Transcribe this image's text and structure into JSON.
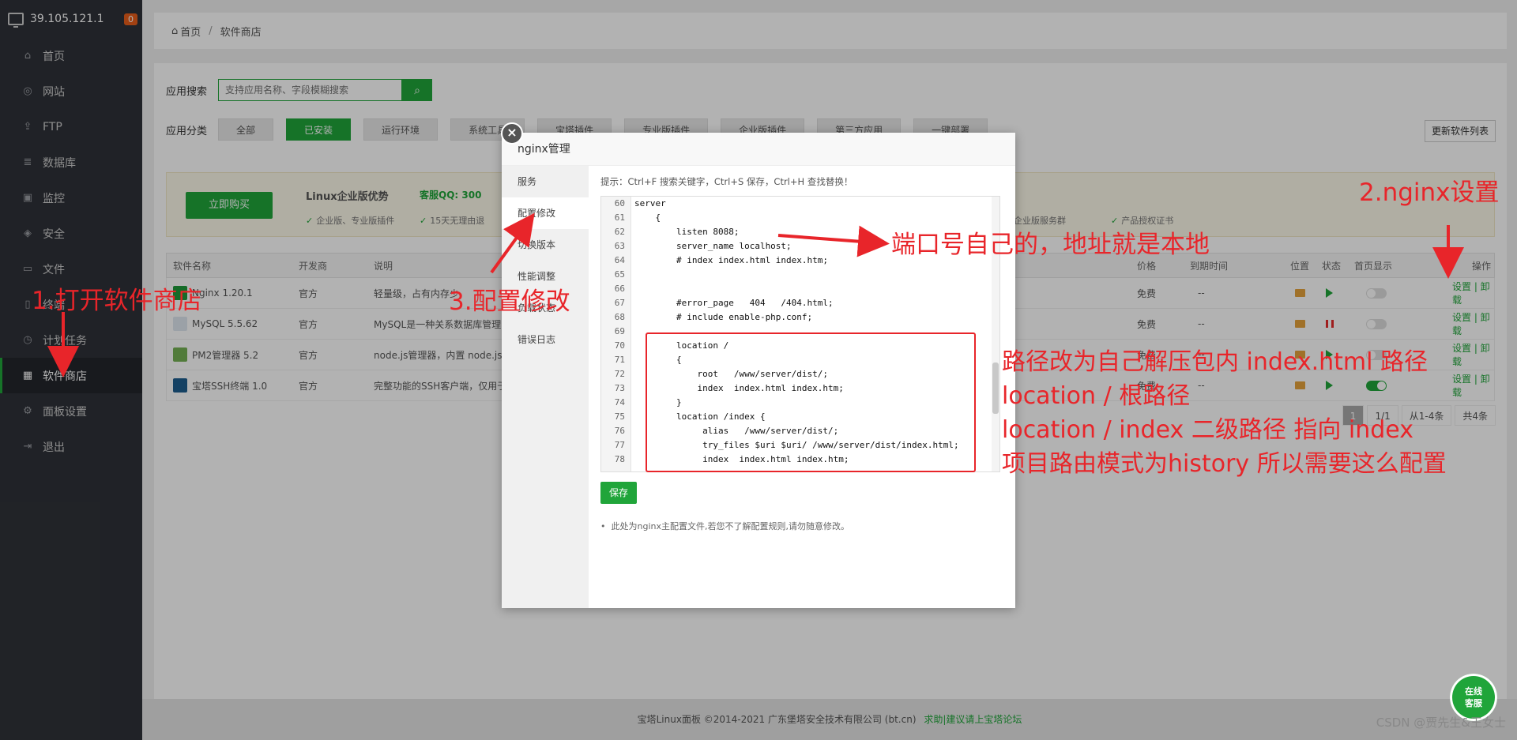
{
  "sidebar": {
    "ip": "39.105.121.1",
    "badge": "0",
    "items": [
      {
        "label": "首页",
        "icon": "⌂"
      },
      {
        "label": "网站",
        "icon": "◎"
      },
      {
        "label": "FTP",
        "icon": "⇪"
      },
      {
        "label": "数据库",
        "icon": "≣"
      },
      {
        "label": "监控",
        "icon": "▣"
      },
      {
        "label": "安全",
        "icon": "◈"
      },
      {
        "label": "文件",
        "icon": "▭"
      },
      {
        "label": "终端",
        "icon": "▯"
      },
      {
        "label": "计划任务",
        "icon": "◷"
      },
      {
        "label": "软件商店",
        "icon": "▦"
      },
      {
        "label": "面板设置",
        "icon": "⚙"
      },
      {
        "label": "退出",
        "icon": "⇥"
      }
    ]
  },
  "breadcrumb": {
    "home": "首页",
    "sep": "/",
    "current": "软件商店"
  },
  "search": {
    "label": "应用搜索",
    "placeholder": "支持应用名称、字段模糊搜索"
  },
  "categories": {
    "label": "应用分类",
    "items": [
      "全部",
      "已安装",
      "运行环境",
      "系统工具",
      "宝塔插件",
      "专业版插件",
      "企业版插件",
      "第三方应用",
      "一键部署"
    ],
    "refresh": "更新软件列表"
  },
  "promo": {
    "buy": "立即购买",
    "title": "Linux企业版优势",
    "qq": "客服QQ: 300",
    "features": [
      "企业版、专业版插件",
      "15天无理由退",
      "年付企业版服务群",
      "产品授权证书"
    ]
  },
  "table": {
    "headers": {
      "name": "软件名称",
      "dev": "开发商",
      "desc": "说明",
      "price": "价格",
      "expire": "到期时间",
      "loc": "位置",
      "status": "状态",
      "home": "首页显示",
      "op": "操作"
    },
    "rows": [
      {
        "name": "Nginx 1.20.1",
        "dev": "官方",
        "desc": "轻量级，占有内存少",
        "price": "免费",
        "expire": "--",
        "ops": "设置 | 卸载"
      },
      {
        "name": "MySQL 5.5.62",
        "dev": "官方",
        "desc": "MySQL是一种关系数据库管理",
        "price": "免费",
        "expire": "--",
        "ops": "设置 | 卸载"
      },
      {
        "name": "PM2管理器 5.2",
        "dev": "官方",
        "desc": "node.js管理器，内置 node.js",
        "price": "免费",
        "expire": "--",
        "ops": "设置 | 卸载"
      },
      {
        "name": "宝塔SSH终端 1.0",
        "dev": "官方",
        "desc": "完整功能的SSH客户端，仅用于",
        "price": "免费",
        "expire": "--",
        "ops": "设置 | 卸载"
      }
    ],
    "pager": {
      "page": "1",
      "of": "1/1",
      "range": "从1-4条",
      "total": "共4条"
    }
  },
  "modal": {
    "title": "nginx管理",
    "nav": [
      "服务",
      "配置修改",
      "切换版本",
      "性能调整",
      "负载状态",
      "错误日志"
    ],
    "hint": "提示：Ctrl+F 搜索关键字，Ctrl+S 保存，Ctrl+H 查找替换！",
    "code": [
      {
        "n": "60",
        "t": "server"
      },
      {
        "n": "61",
        "t": "    {"
      },
      {
        "n": "62",
        "t": "        listen 8088;"
      },
      {
        "n": "63",
        "t": "        server_name localhost;"
      },
      {
        "n": "64",
        "t": "        # index index.html index.htm;"
      },
      {
        "n": "65",
        "t": ""
      },
      {
        "n": "66",
        "t": ""
      },
      {
        "n": "67",
        "t": "        #error_page   404   /404.html;"
      },
      {
        "n": "68",
        "t": "        # include enable-php.conf;"
      },
      {
        "n": "69",
        "t": ""
      },
      {
        "n": "70",
        "t": "        location /"
      },
      {
        "n": "71",
        "t": "        {"
      },
      {
        "n": "72",
        "t": "            root   /www/server/dist/;"
      },
      {
        "n": "73",
        "t": "            index  index.html index.htm;"
      },
      {
        "n": "74",
        "t": "        }"
      },
      {
        "n": "75",
        "t": "        location /index {"
      },
      {
        "n": "76",
        "t": "             alias   /www/server/dist/;"
      },
      {
        "n": "77",
        "t": "             try_files $uri $uri/ /www/server/dist/index.html;"
      },
      {
        "n": "78",
        "t": "             index  index.html index.htm;"
      }
    ],
    "save": "保存",
    "note": "此处为nginx主配置文件,若您不了解配置规则,请勿随意修改。"
  },
  "annotations": {
    "step1": "1.打开软件商店",
    "step2": "2.nginx设置",
    "step3": "3.配置修改",
    "port": "端口号自己的，地址就是本地",
    "path1": "路径改为自己解压包内 index.html 路径",
    "path2": "location /  根路径",
    "path3": "location / index 二级路径 指向 index",
    "path4": "项目路由模式为history 所以需要这么配置"
  },
  "footer": {
    "copy": "宝塔Linux面板 ©2014-2021 广东堡塔安全技术有限公司 (bt.cn)",
    "link": "求助|建议请上宝塔论坛"
  },
  "chat": {
    "l1": "在线",
    "l2": "客服"
  },
  "watermark": "CSDN @贾先生&王女士"
}
